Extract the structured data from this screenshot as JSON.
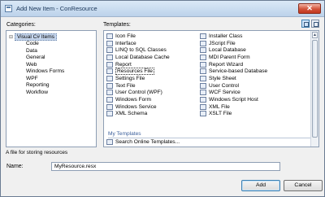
{
  "window": {
    "title": "Add New Item - ConResource",
    "close_glyph": "✕"
  },
  "labels": {
    "categories": "Categories:",
    "templates": "Templates:",
    "name": "Name:"
  },
  "categories": {
    "root": "Visual C# Items",
    "toggle": "⊟",
    "children": [
      "Code",
      "Data",
      "General",
      "Web",
      "Windows Forms",
      "WPF",
      "Reporting",
      "Workflow"
    ]
  },
  "templates": {
    "left": [
      "Icon File",
      "Interface",
      "LINQ to SQL Classes",
      "Local Database Cache",
      "Report",
      "Resources File",
      "Settings File",
      "Text File",
      "User Control (WPF)",
      "Windows Form",
      "Windows Service",
      "XML Schema"
    ],
    "right": [
      "Installer Class",
      "JScript File",
      "Local Database",
      "MDI Parent Form",
      "Report Wizard",
      "Service-based Database",
      "Style Sheet",
      "User Control",
      "WCF Service",
      "Windows Script Host",
      "XML File",
      "XSLT File"
    ],
    "selected": "Resources File",
    "my_templates_header": "My Templates",
    "search_online": "Search Online Templates..."
  },
  "description": "A file for storing resources",
  "name_field": {
    "value": "MyResource.resx"
  },
  "buttons": {
    "add": "Add",
    "cancel": "Cancel"
  }
}
